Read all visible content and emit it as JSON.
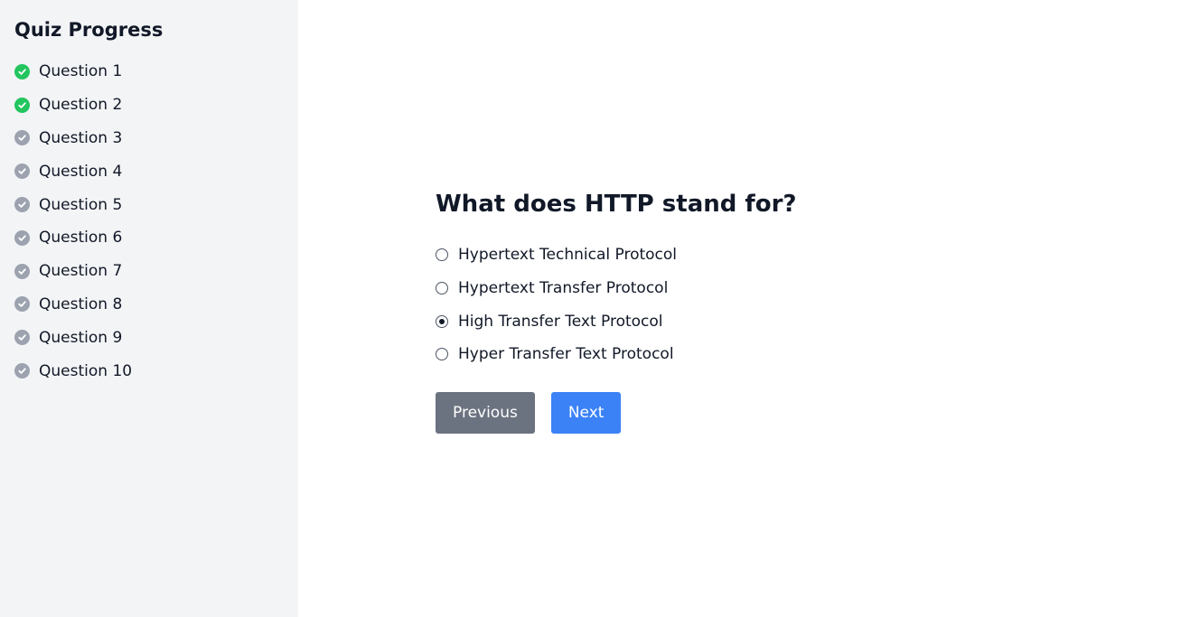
{
  "sidebar": {
    "title": "Quiz Progress",
    "items": [
      {
        "label": "Question 1",
        "status": "answered"
      },
      {
        "label": "Question 2",
        "status": "answered"
      },
      {
        "label": "Question 3",
        "status": "unanswered"
      },
      {
        "label": "Question 4",
        "status": "unanswered"
      },
      {
        "label": "Question 5",
        "status": "unanswered"
      },
      {
        "label": "Question 6",
        "status": "unanswered"
      },
      {
        "label": "Question 7",
        "status": "unanswered"
      },
      {
        "label": "Question 8",
        "status": "unanswered"
      },
      {
        "label": "Question 9",
        "status": "unanswered"
      },
      {
        "label": "Question 10",
        "status": "unanswered"
      }
    ]
  },
  "question": {
    "text": "What does HTTP stand for?",
    "options": [
      {
        "label": "Hypertext Technical Protocol",
        "selected": false
      },
      {
        "label": "Hypertext Transfer Protocol",
        "selected": false
      },
      {
        "label": "High Transfer Text Protocol",
        "selected": true
      },
      {
        "label": "Hyper Transfer Text Protocol",
        "selected": false
      }
    ]
  },
  "buttons": {
    "previous_label": "Previous",
    "next_label": "Next"
  },
  "colors": {
    "answered": "#22c55e",
    "unanswered": "#9ca3af",
    "sidebar_bg": "#f3f4f6",
    "previous_button": "#6b7280",
    "next_button": "#3b82f6"
  },
  "icons": {
    "status": "check-circle-icon"
  }
}
